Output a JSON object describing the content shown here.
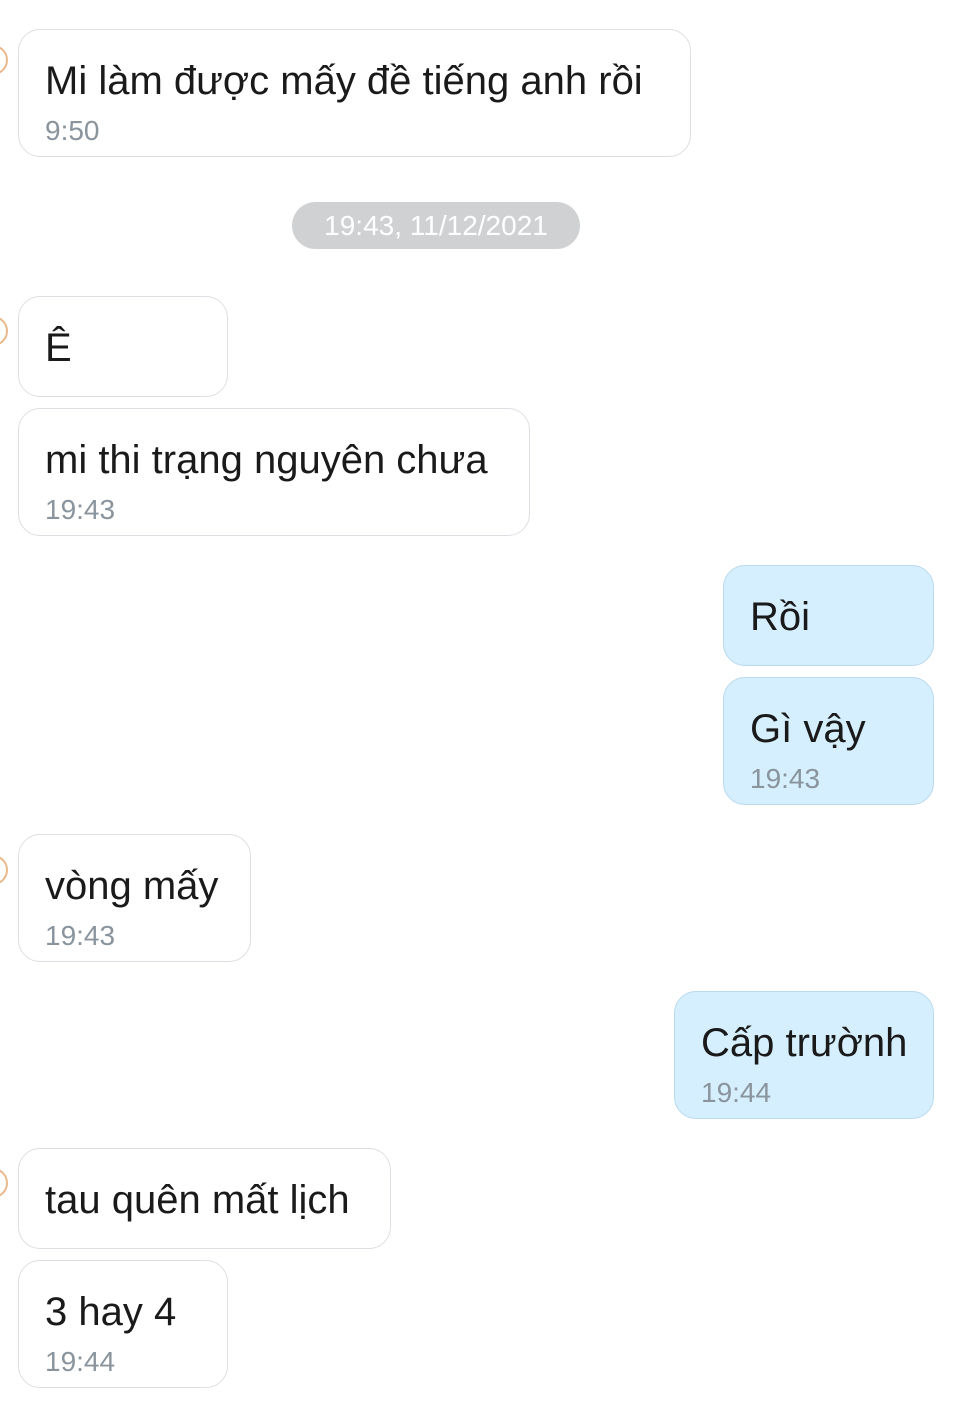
{
  "date_separator": "19:43, 11/12/2021",
  "messages": [
    {
      "text": "Mi làm được mấy đề tiếng anh rồi",
      "time": "9:50"
    },
    {
      "text": "Ê"
    },
    {
      "text": "mi thi trạng nguyên chưa",
      "time": "19:43"
    },
    {
      "text": "Rồi"
    },
    {
      "text": "Gì vậy",
      "time": "19:43"
    },
    {
      "text": "vòng mấy",
      "time": "19:43"
    },
    {
      "text": "Cấp trườnh",
      "time": "19:44"
    },
    {
      "text": "tau quên mất lịch"
    },
    {
      "text": "3 hay 4",
      "time": "19:44"
    }
  ],
  "colors": {
    "incoming_bubble": "#ffffff",
    "outgoing_bubble": "#d6efff",
    "date_chip": "#cfd1d3",
    "timestamp": "#8a949c"
  }
}
